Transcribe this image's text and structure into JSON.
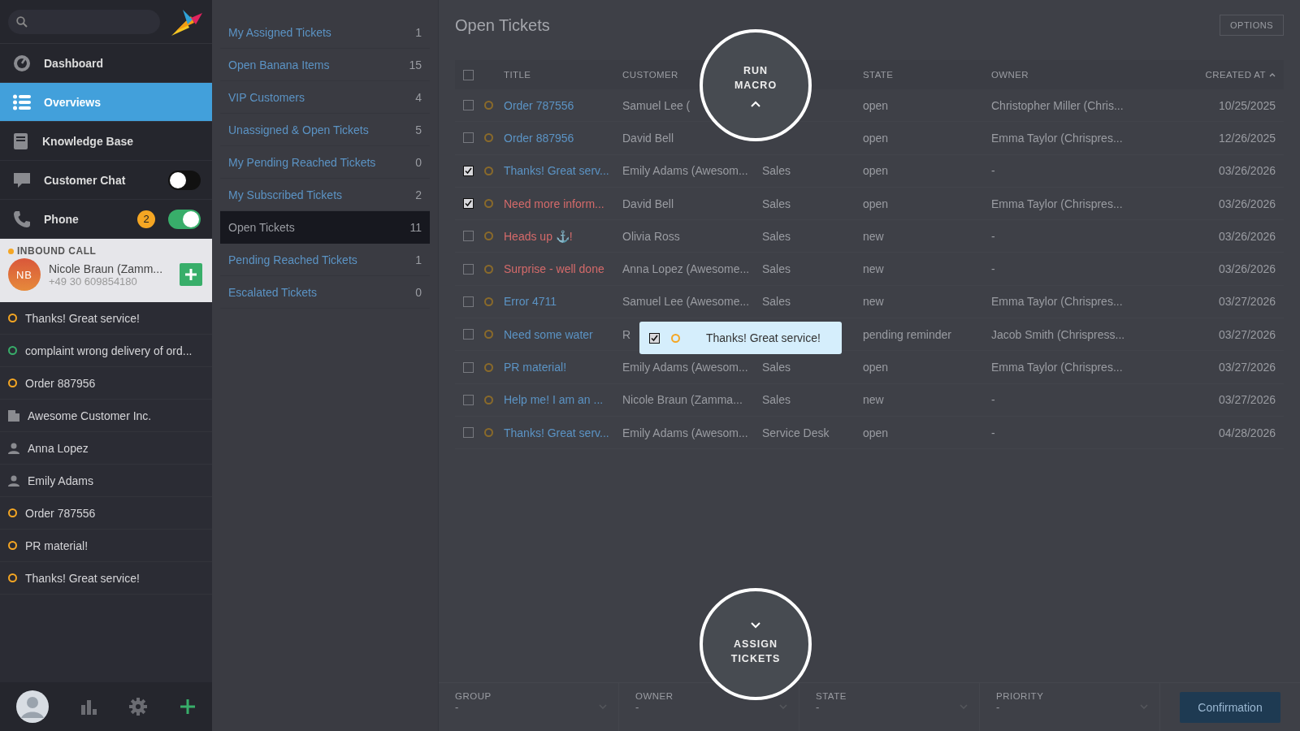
{
  "sidebar": {
    "nav": [
      {
        "kind": "dashboard",
        "label": "Dashboard",
        "selected": false
      },
      {
        "kind": "overviews",
        "label": "Overviews",
        "selected": true
      },
      {
        "kind": "knowledge",
        "label": "Knowledge Base",
        "selected": false
      },
      {
        "kind": "chat",
        "label": "Customer Chat",
        "selected": false,
        "on": false
      },
      {
        "kind": "phone",
        "label": "Phone",
        "selected": false,
        "on": true,
        "badge": "2"
      }
    ],
    "call": {
      "heading": "INBOUND CALL",
      "initials": "NB",
      "name": "Nicole Braun (Zamm...",
      "number": "+49 30 609854180"
    },
    "recent": [
      {
        "kind": "ticket",
        "color": "#f5a623",
        "label": "Thanks! Great service!"
      },
      {
        "kind": "ticket",
        "color": "#38ae6a",
        "label": "complaint wrong delivery of ord..."
      },
      {
        "kind": "ticket",
        "color": "#f5a623",
        "label": "Order 887956"
      },
      {
        "kind": "organization",
        "label": "Awesome Customer Inc."
      },
      {
        "kind": "user",
        "label": "Anna Lopez"
      },
      {
        "kind": "user",
        "label": "Emily Adams"
      },
      {
        "kind": "ticket",
        "color": "#f5a623",
        "label": "Order 787556"
      },
      {
        "kind": "ticket",
        "color": "#f5a623",
        "label": "PR material!"
      },
      {
        "kind": "ticket",
        "color": "#f5a623",
        "label": "Thanks! Great service!"
      }
    ]
  },
  "overviews": [
    {
      "label": "My Assigned Tickets",
      "count": "1",
      "selected": false
    },
    {
      "label": "Open Banana Items",
      "count": "15",
      "selected": false
    },
    {
      "label": "VIP Customers",
      "count": "4",
      "selected": false
    },
    {
      "label": "Unassigned & Open Tickets",
      "count": "5",
      "selected": false
    },
    {
      "label": "My Pending Reached Tickets",
      "count": "0",
      "selected": false
    },
    {
      "label": "My Subscribed Tickets",
      "count": "2",
      "selected": false
    },
    {
      "label": "Open Tickets",
      "count": "11",
      "selected": true
    },
    {
      "label": "Pending Reached Tickets",
      "count": "1",
      "selected": false
    },
    {
      "label": "Escalated Tickets",
      "count": "0",
      "selected": false
    }
  ],
  "main": {
    "title": "Open Tickets",
    "options_button": "OPTIONS",
    "table": {
      "columns": [
        "TITLE",
        "CUSTOMER",
        "STATE",
        "OWNER",
        "CREATED AT"
      ],
      "sorted_ascending": true,
      "header_checked": false,
      "rows": [
        {
          "checked": false,
          "escalated": false,
          "title": "Order 787556",
          "customer": "Samuel Lee (",
          "state": "open",
          "owner": "Christopher Miller (Chris...",
          "created": "10/25/2025"
        },
        {
          "checked": false,
          "escalated": false,
          "title": "Order 887956",
          "customer": "David Bell",
          "state": "open",
          "owner": "Emma Taylor (Chrispres...",
          "created": "12/26/2025"
        },
        {
          "checked": true,
          "escalated": false,
          "title": "Thanks! Great serv...",
          "customer": "Emily Adams (Awesom...",
          "group": "Sales",
          "state": "open",
          "owner": "-",
          "created": "03/26/2026"
        },
        {
          "checked": true,
          "escalated": true,
          "title": "Need more inform...",
          "customer": "David Bell",
          "group": "Sales",
          "state": "open",
          "owner": "Emma Taylor (Chrispres...",
          "created": "03/26/2026"
        },
        {
          "checked": false,
          "escalated": true,
          "title": "Heads up ⚓!",
          "customer": "Olivia Ross",
          "group": "Sales",
          "state": "new",
          "owner": "-",
          "created": "03/26/2026"
        },
        {
          "checked": false,
          "escalated": true,
          "title": "Surprise - well done",
          "customer": "Anna Lopez (Awesome...",
          "group": "Sales",
          "state": "new",
          "owner": "-",
          "created": "03/26/2026"
        },
        {
          "checked": false,
          "escalated": false,
          "title": "Error 4711",
          "customer": "Samuel Lee (Awesome...",
          "group": "Sales",
          "state": "new",
          "owner": "Emma Taylor (Chrispres...",
          "created": "03/27/2026"
        },
        {
          "checked": false,
          "escalated": false,
          "title": "Need some water",
          "customer": "R",
          "state": "pending reminder",
          "owner": "Jacob Smith (Chrispress...",
          "created": "03/27/2026"
        },
        {
          "checked": false,
          "escalated": false,
          "title": "PR material!",
          "customer": "Emily Adams (Awesom...",
          "group": "Sales",
          "state": "open",
          "owner": "Emma Taylor (Chrispres...",
          "created": "03/27/2026"
        },
        {
          "checked": false,
          "escalated": false,
          "title": "Help me! I am an ...",
          "customer": "Nicole Braun (Zamma...",
          "group": "Sales",
          "state": "new",
          "owner": "-",
          "created": "03/27/2026"
        },
        {
          "checked": false,
          "escalated": false,
          "title": "Thanks! Great serv...",
          "customer": "Emily Adams (Awesom...",
          "group": "Service Desk",
          "state": "open",
          "owner": "-",
          "created": "04/28/2026"
        }
      ]
    },
    "drag_item": {
      "checked": true,
      "title": "Thanks! Great service!"
    },
    "run_macro": "RUN\nMACRO",
    "assign_tickets": "ASSIGN\nTICKETS",
    "bulk": {
      "fields": [
        {
          "label": "GROUP",
          "value": "-"
        },
        {
          "label": "OWNER",
          "value": "-"
        },
        {
          "label": "STATE",
          "value": "-"
        },
        {
          "label": "PRIORITY",
          "value": "-"
        }
      ],
      "confirm": "Confirmation"
    }
  }
}
